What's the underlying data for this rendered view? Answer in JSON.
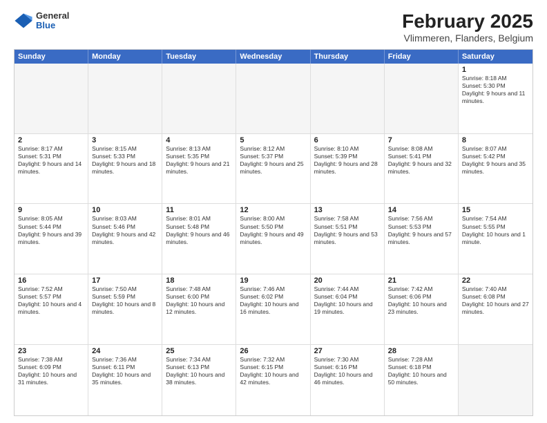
{
  "header": {
    "logo_general": "General",
    "logo_blue": "Blue",
    "title": "February 2025",
    "subtitle": "Vlimmeren, Flanders, Belgium"
  },
  "days": [
    "Sunday",
    "Monday",
    "Tuesday",
    "Wednesday",
    "Thursday",
    "Friday",
    "Saturday"
  ],
  "weeks": [
    [
      {
        "day": "",
        "text": ""
      },
      {
        "day": "",
        "text": ""
      },
      {
        "day": "",
        "text": ""
      },
      {
        "day": "",
        "text": ""
      },
      {
        "day": "",
        "text": ""
      },
      {
        "day": "",
        "text": ""
      },
      {
        "day": "1",
        "text": "Sunrise: 8:18 AM\nSunset: 5:30 PM\nDaylight: 9 hours and 11 minutes."
      }
    ],
    [
      {
        "day": "2",
        "text": "Sunrise: 8:17 AM\nSunset: 5:31 PM\nDaylight: 9 hours and 14 minutes."
      },
      {
        "day": "3",
        "text": "Sunrise: 8:15 AM\nSunset: 5:33 PM\nDaylight: 9 hours and 18 minutes."
      },
      {
        "day": "4",
        "text": "Sunrise: 8:13 AM\nSunset: 5:35 PM\nDaylight: 9 hours and 21 minutes."
      },
      {
        "day": "5",
        "text": "Sunrise: 8:12 AM\nSunset: 5:37 PM\nDaylight: 9 hours and 25 minutes."
      },
      {
        "day": "6",
        "text": "Sunrise: 8:10 AM\nSunset: 5:39 PM\nDaylight: 9 hours and 28 minutes."
      },
      {
        "day": "7",
        "text": "Sunrise: 8:08 AM\nSunset: 5:41 PM\nDaylight: 9 hours and 32 minutes."
      },
      {
        "day": "8",
        "text": "Sunrise: 8:07 AM\nSunset: 5:42 PM\nDaylight: 9 hours and 35 minutes."
      }
    ],
    [
      {
        "day": "9",
        "text": "Sunrise: 8:05 AM\nSunset: 5:44 PM\nDaylight: 9 hours and 39 minutes."
      },
      {
        "day": "10",
        "text": "Sunrise: 8:03 AM\nSunset: 5:46 PM\nDaylight: 9 hours and 42 minutes."
      },
      {
        "day": "11",
        "text": "Sunrise: 8:01 AM\nSunset: 5:48 PM\nDaylight: 9 hours and 46 minutes."
      },
      {
        "day": "12",
        "text": "Sunrise: 8:00 AM\nSunset: 5:50 PM\nDaylight: 9 hours and 49 minutes."
      },
      {
        "day": "13",
        "text": "Sunrise: 7:58 AM\nSunset: 5:51 PM\nDaylight: 9 hours and 53 minutes."
      },
      {
        "day": "14",
        "text": "Sunrise: 7:56 AM\nSunset: 5:53 PM\nDaylight: 9 hours and 57 minutes."
      },
      {
        "day": "15",
        "text": "Sunrise: 7:54 AM\nSunset: 5:55 PM\nDaylight: 10 hours and 1 minute."
      }
    ],
    [
      {
        "day": "16",
        "text": "Sunrise: 7:52 AM\nSunset: 5:57 PM\nDaylight: 10 hours and 4 minutes."
      },
      {
        "day": "17",
        "text": "Sunrise: 7:50 AM\nSunset: 5:59 PM\nDaylight: 10 hours and 8 minutes."
      },
      {
        "day": "18",
        "text": "Sunrise: 7:48 AM\nSunset: 6:00 PM\nDaylight: 10 hours and 12 minutes."
      },
      {
        "day": "19",
        "text": "Sunrise: 7:46 AM\nSunset: 6:02 PM\nDaylight: 10 hours and 16 minutes."
      },
      {
        "day": "20",
        "text": "Sunrise: 7:44 AM\nSunset: 6:04 PM\nDaylight: 10 hours and 19 minutes."
      },
      {
        "day": "21",
        "text": "Sunrise: 7:42 AM\nSunset: 6:06 PM\nDaylight: 10 hours and 23 minutes."
      },
      {
        "day": "22",
        "text": "Sunrise: 7:40 AM\nSunset: 6:08 PM\nDaylight: 10 hours and 27 minutes."
      }
    ],
    [
      {
        "day": "23",
        "text": "Sunrise: 7:38 AM\nSunset: 6:09 PM\nDaylight: 10 hours and 31 minutes."
      },
      {
        "day": "24",
        "text": "Sunrise: 7:36 AM\nSunset: 6:11 PM\nDaylight: 10 hours and 35 minutes."
      },
      {
        "day": "25",
        "text": "Sunrise: 7:34 AM\nSunset: 6:13 PM\nDaylight: 10 hours and 38 minutes."
      },
      {
        "day": "26",
        "text": "Sunrise: 7:32 AM\nSunset: 6:15 PM\nDaylight: 10 hours and 42 minutes."
      },
      {
        "day": "27",
        "text": "Sunrise: 7:30 AM\nSunset: 6:16 PM\nDaylight: 10 hours and 46 minutes."
      },
      {
        "day": "28",
        "text": "Sunrise: 7:28 AM\nSunset: 6:18 PM\nDaylight: 10 hours and 50 minutes."
      },
      {
        "day": "",
        "text": ""
      }
    ]
  ]
}
